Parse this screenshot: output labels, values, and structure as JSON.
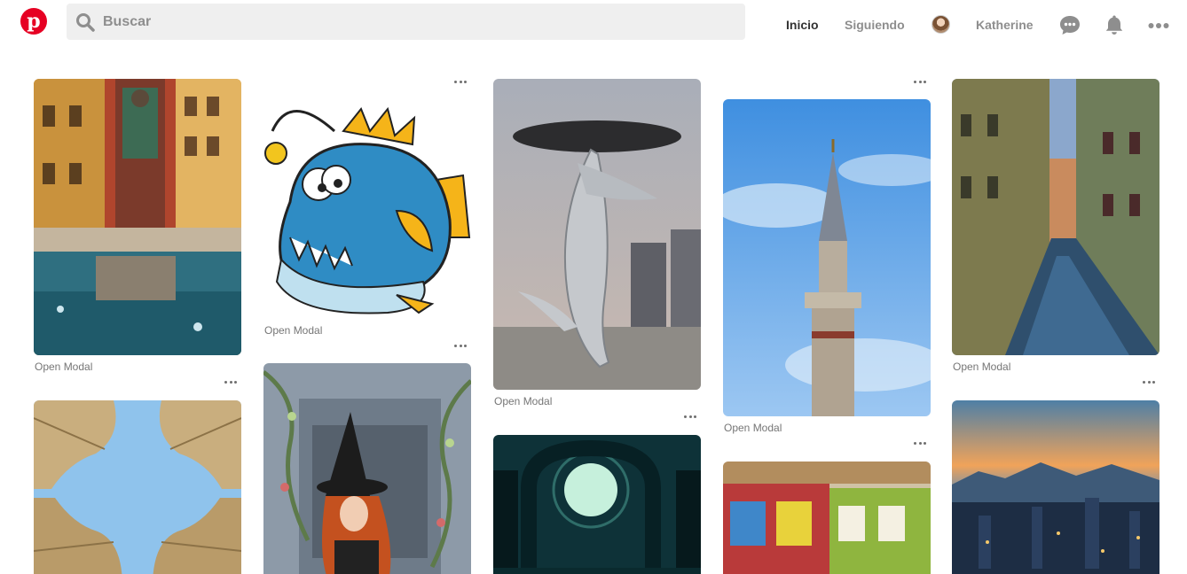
{
  "header": {
    "logo_letter": "p",
    "search_placeholder": "Buscar",
    "nav": {
      "home": "Inicio",
      "following": "Siguiendo",
      "user": "Katherine"
    }
  },
  "pins": [
    {
      "caption": "Open Modal",
      "image": "fountain-town-square"
    },
    {
      "caption": "",
      "image": "sunshade-sky"
    },
    {
      "caption": "Open Modal",
      "image": "anglerfish-cartoon"
    },
    {
      "caption": "",
      "image": "witch-girl-portrait"
    },
    {
      "caption": "Open Modal",
      "image": "whale-statue-city"
    },
    {
      "caption": "",
      "image": "moon-arches-night"
    },
    {
      "caption": "Open Modal",
      "image": "minaret-blue-sky"
    },
    {
      "caption": "",
      "image": "colorful-houses"
    },
    {
      "caption": "Open Modal",
      "image": "venice-canal"
    },
    {
      "caption": "",
      "image": "city-sunset-skyline"
    }
  ],
  "colors": {
    "brand": "#e60023",
    "search_bg": "#efefef",
    "muted_text": "#8e8e8e"
  },
  "icons": [
    "pinterest-logo-icon",
    "search-icon",
    "chat-icon",
    "bell-icon",
    "more-icon"
  ]
}
